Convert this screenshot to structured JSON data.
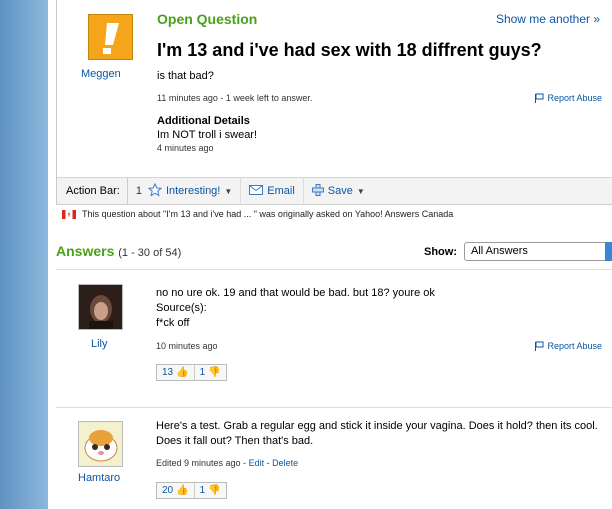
{
  "question": {
    "header_label": "Open Question",
    "show_another": "Show me another »",
    "asker": "Meggen",
    "title": "I'm 13 and i've had sex with 18 diffrent guys?",
    "body": "is that bad?",
    "meta": "11 minutes ago - 1 week left to answer.",
    "report": "Report Abuse",
    "additional_title": "Additional Details",
    "additional_body": "Im NOT troll i swear!",
    "additional_time": "4 minutes ago"
  },
  "action_bar": {
    "label": "Action Bar:",
    "interesting_count": "1",
    "interesting": "Interesting!",
    "email": "Email",
    "save": "Save"
  },
  "origin_note": "This question about \"I'm 13 and i've had ... \" was originally asked on Yahoo! Answers Canada",
  "answers_header": {
    "title": "Answers",
    "range": "(1 - 30 of 54)",
    "show_label": "Show:",
    "filter_value": "All Answers"
  },
  "answers": [
    {
      "name": "Lily",
      "text": "no no ure ok. 19 and that would be bad. but 18? youre ok",
      "sources_label": "Source(s):",
      "source": "f*ck off",
      "meta": "10 minutes ago",
      "report": "Report Abuse",
      "thumbs_up": "13",
      "thumbs_down": "1"
    },
    {
      "name": "Hamtaro",
      "text": "Here's a test. Grab a regular egg and stick it inside your vagina. Does it hold? then its cool. Does it fall out? Then that's bad.",
      "meta_prefix": "Edited 9 minutes ago - ",
      "edit": "Edit",
      "delete": "Delete",
      "thumbs_up": "20",
      "thumbs_down": "1"
    }
  ],
  "colors": {
    "green": "#4aa016",
    "link": "#0b56a5",
    "avatar_orange": "#f5a51b",
    "sidebar": "#7aa9d3"
  }
}
